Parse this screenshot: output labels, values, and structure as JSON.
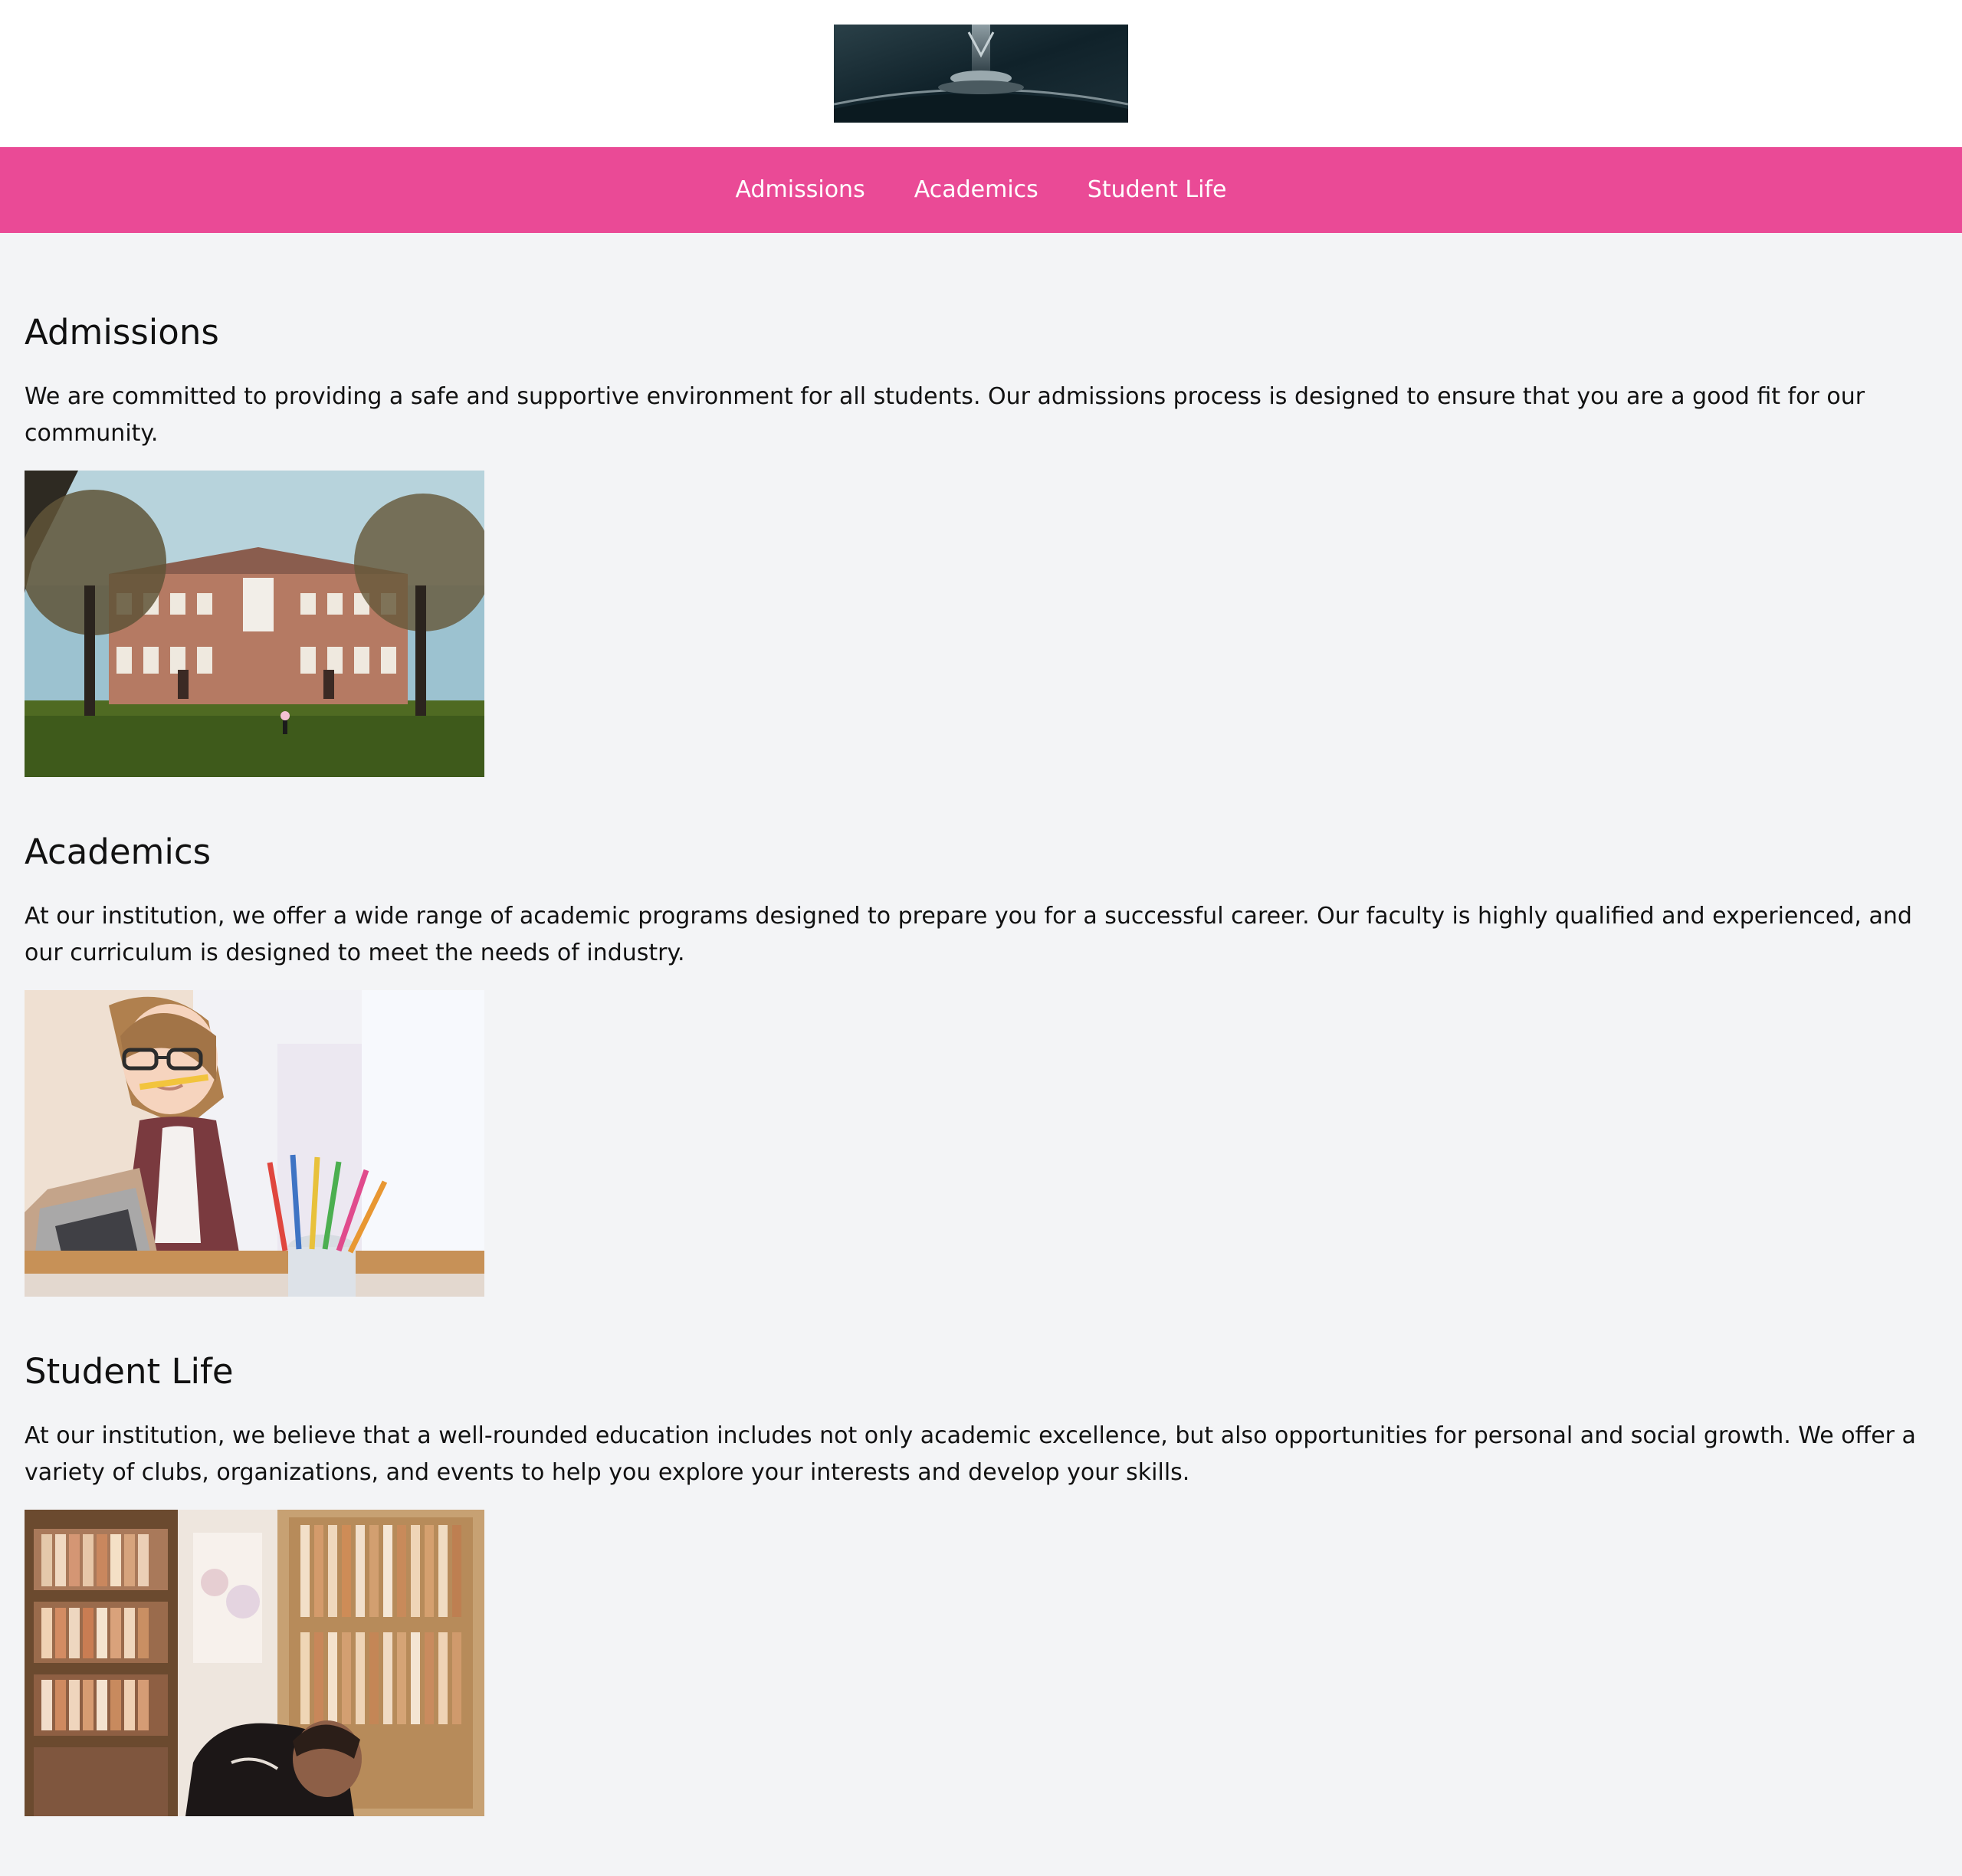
{
  "header": {
    "logo_name": "car-hood-ornament-logo"
  },
  "nav": {
    "items": [
      "Admissions",
      "Academics",
      "Student Life"
    ]
  },
  "sections": [
    {
      "title": "Admissions",
      "text": "We are committed to providing a safe and supportive environment for all students. Our admissions process is designed to ensure that you are a good fit for our community.",
      "image_name": "campus-building-photo"
    },
    {
      "title": "Academics",
      "text": "At our institution, we offer a wide range of academic programs designed to prepare you for a successful career. Our faculty is highly qualified and experienced, and our curriculum is designed to meet the needs of industry.",
      "image_name": "student-laptop-photo"
    },
    {
      "title": "Student Life",
      "text": "At our institution, we believe that a well-rounded education includes not only academic excellence, but also opportunities for personal and social growth. We offer a variety of clubs, organizations, and events to help you explore your interests and develop your skills.",
      "image_name": "library-student-photo"
    }
  ],
  "colors": {
    "nav_bg": "#ea4a96",
    "page_bg": "#f3f4f6",
    "header_bg": "#ffffff"
  }
}
